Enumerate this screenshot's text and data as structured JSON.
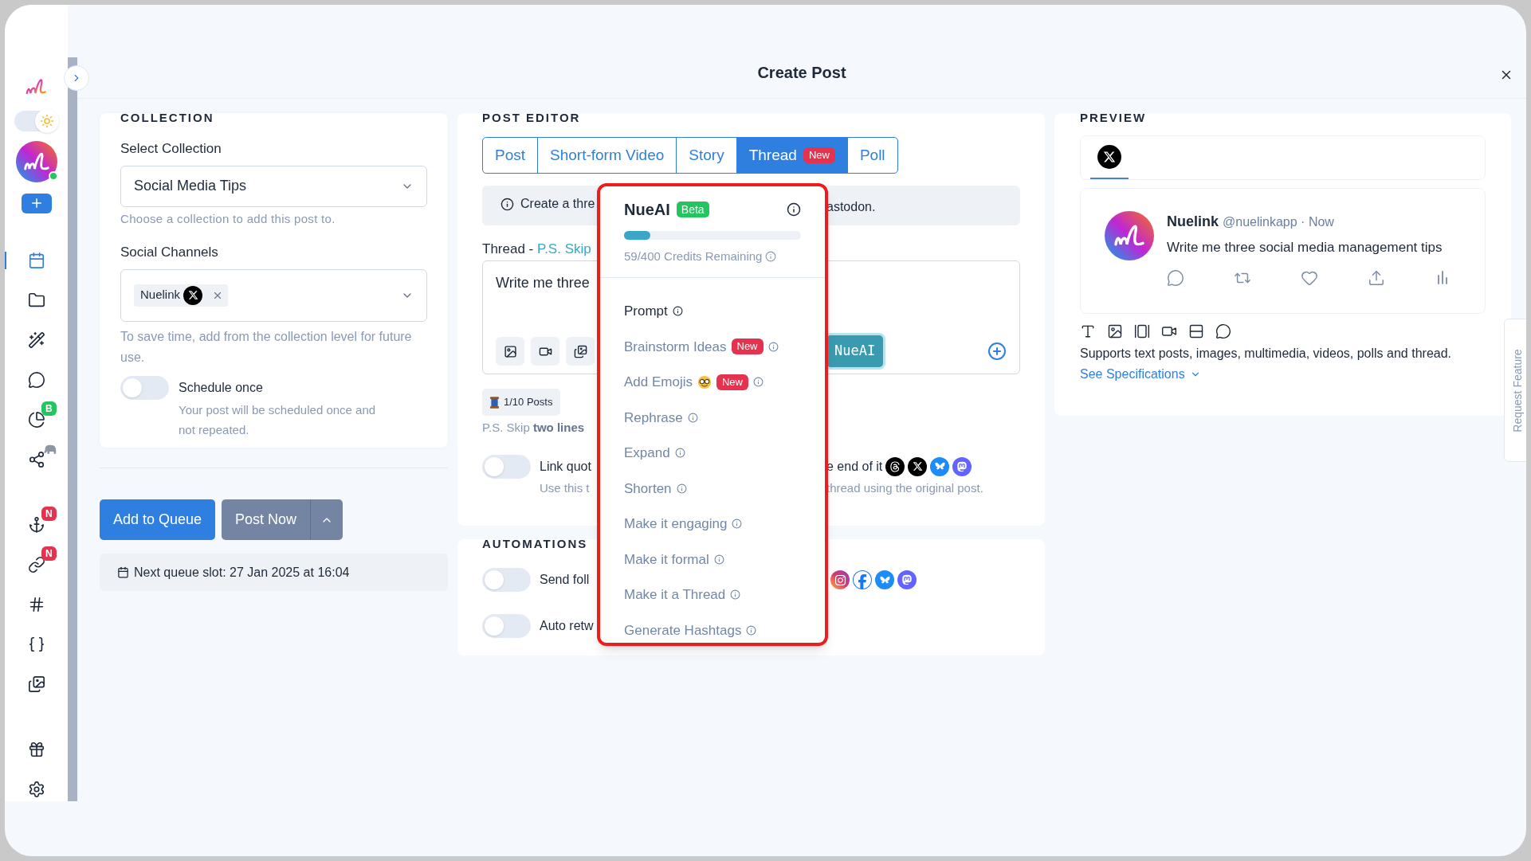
{
  "window": {
    "title": "Create Post"
  },
  "sidebar": {
    "theme_toggle": {
      "on": true
    },
    "groups": [
      [
        {
          "selected": true
        },
        {
          "selected": false
        },
        {
          "selected": false
        },
        {
          "selected": false
        },
        {
          "selected": false,
          "badge": {
            "text": "B",
            "color": "#22c55e"
          }
        },
        {
          "selected": false,
          "emoji_badge": true
        }
      ],
      [
        {
          "selected": false,
          "badge": {
            "text": "N",
            "color": "#e5334f"
          }
        },
        {
          "selected": false,
          "badge": {
            "text": "N",
            "color": "#e5334f"
          }
        },
        {
          "selected": false
        },
        {
          "selected": false
        },
        {
          "selected": false
        }
      ],
      [
        {
          "selected": false
        },
        {
          "selected": false
        }
      ]
    ]
  },
  "collection": {
    "heading": "COLLECTION",
    "select_label": "Select Collection",
    "select_value": "Social Media Tips",
    "select_hint": "Choose a collection to add this post to.",
    "channels_label": "Social Channels",
    "channel_chips": [
      {
        "name": "Nuelink"
      }
    ],
    "channels_hint": "To save time, add from the collection level for future use.",
    "schedule": {
      "label": "Schedule once",
      "description": "Your post will be scheduled once and not repeated.",
      "on": false
    }
  },
  "actions": {
    "add_to_queue": "Add to Queue",
    "post_now": "Post Now",
    "next_slot": "Next queue slot: 27 Jan 2025 at 16:04"
  },
  "editor": {
    "heading": "POST EDITOR",
    "tabs": [
      {
        "label": "Post",
        "selected": false
      },
      {
        "label": "Short-form Video",
        "selected": false
      },
      {
        "label": "Story",
        "selected": false
      },
      {
        "label": "Thread",
        "selected": true,
        "badge": "New"
      },
      {
        "label": "Poll",
        "selected": false
      }
    ],
    "info_left": "Create a thre",
    "info_right": "astodon.",
    "thread_label": "Thread - ",
    "thread_link": "P.S. Skip",
    "text_value": "Write me three",
    "ai_button": "NueAI",
    "posts_count": "1/10 Posts",
    "hint": "P.S. Skip **two lines**",
    "quote": {
      "on": false,
      "label_left": "Link quot",
      "label_right": "e end of it",
      "desc_left": "Use this t",
      "desc_right": "thread using the original post."
    }
  },
  "automations": {
    "heading": "AUTOMATIONS",
    "rows": [
      {
        "label": "Send foll",
        "on": false,
        "networks": true
      },
      {
        "label": "Auto retw",
        "on": false,
        "networks": false
      }
    ]
  },
  "nueai": {
    "title": "NueAI",
    "badge": "Beta",
    "level": 0.1475,
    "credits": "59/400 Credits Remaining",
    "items": [
      {
        "label": "Prompt",
        "selected": true
      },
      {
        "label": "Brainstorm Ideas",
        "selected": false,
        "badge": "New"
      },
      {
        "label": "Add Emojis",
        "selected": false,
        "emoji": true,
        "badge": "New"
      },
      {
        "label": "Rephrase",
        "selected": false
      },
      {
        "label": "Expand",
        "selected": false
      },
      {
        "label": "Shorten",
        "selected": false
      },
      {
        "label": "Make it engaging",
        "selected": false
      },
      {
        "label": "Make it formal",
        "selected": false
      },
      {
        "label": "Make it a Thread",
        "selected": false
      },
      {
        "label": "Generate Hashtags",
        "selected": false
      }
    ]
  },
  "preview": {
    "heading": "PREVIEW",
    "channel_tabs": [
      {
        "selected": true
      }
    ],
    "tweet": {
      "name": "Nuelink",
      "handle": "@nuelinkapp · Now",
      "text": "Write me three social media management tips"
    },
    "supports": "Supports text posts, images, multimedia, videos, polls and thread.",
    "specs_link": "See Specifications"
  },
  "request_feature": "Request Feature"
}
